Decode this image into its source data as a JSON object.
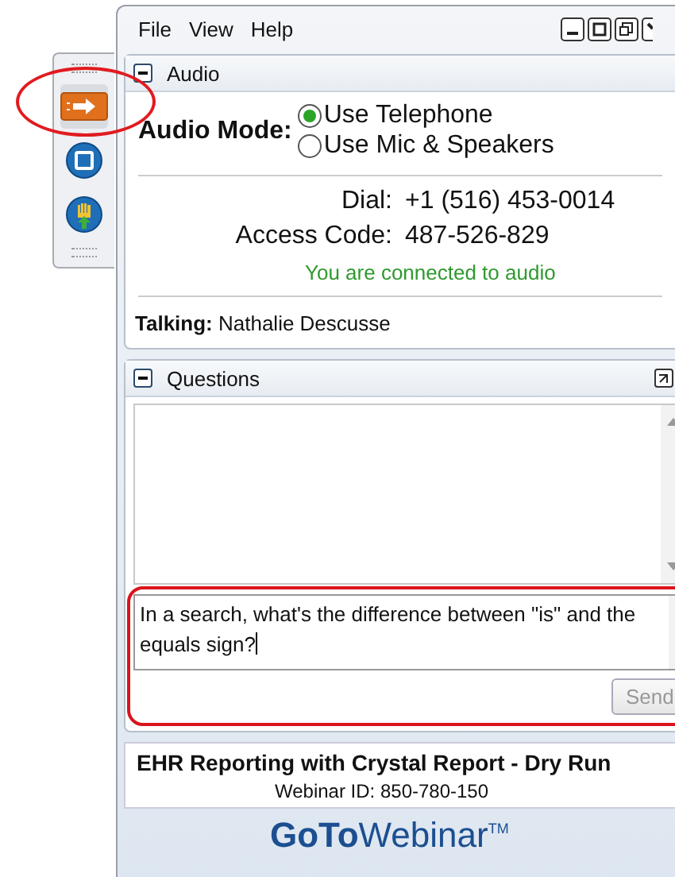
{
  "menu": [
    {
      "label": "File"
    },
    {
      "label": "View"
    },
    {
      "label": "Help"
    }
  ],
  "audio": {
    "title": "Audio",
    "expanded": true,
    "mode_label": "Audio Mode:",
    "options": [
      {
        "label": "Use Telephone",
        "selected": true
      },
      {
        "label": "Use Mic & Speakers",
        "selected": false
      }
    ],
    "dial_label": "Dial:",
    "dial": "+1 (516) 453-0014",
    "code_label": "Access Code:",
    "code": "487-526-829",
    "status": "You are connected to audio",
    "talking": "**Talking:** Nathalie Descusse"
  },
  "questions": {
    "title": "Questions",
    "expanded": true,
    "question": "In a search, what's the difference between \"is\" and the equals sign?",
    "send": "Send",
    "send_disabled": true
  },
  "webinar": {
    "title": "EHR Reporting with Crystal Report - Dry Run",
    "id": "Webinar ID: 850-780-150"
  },
  "logo": "**GoTo**Webinar$^{TM}$"
}
